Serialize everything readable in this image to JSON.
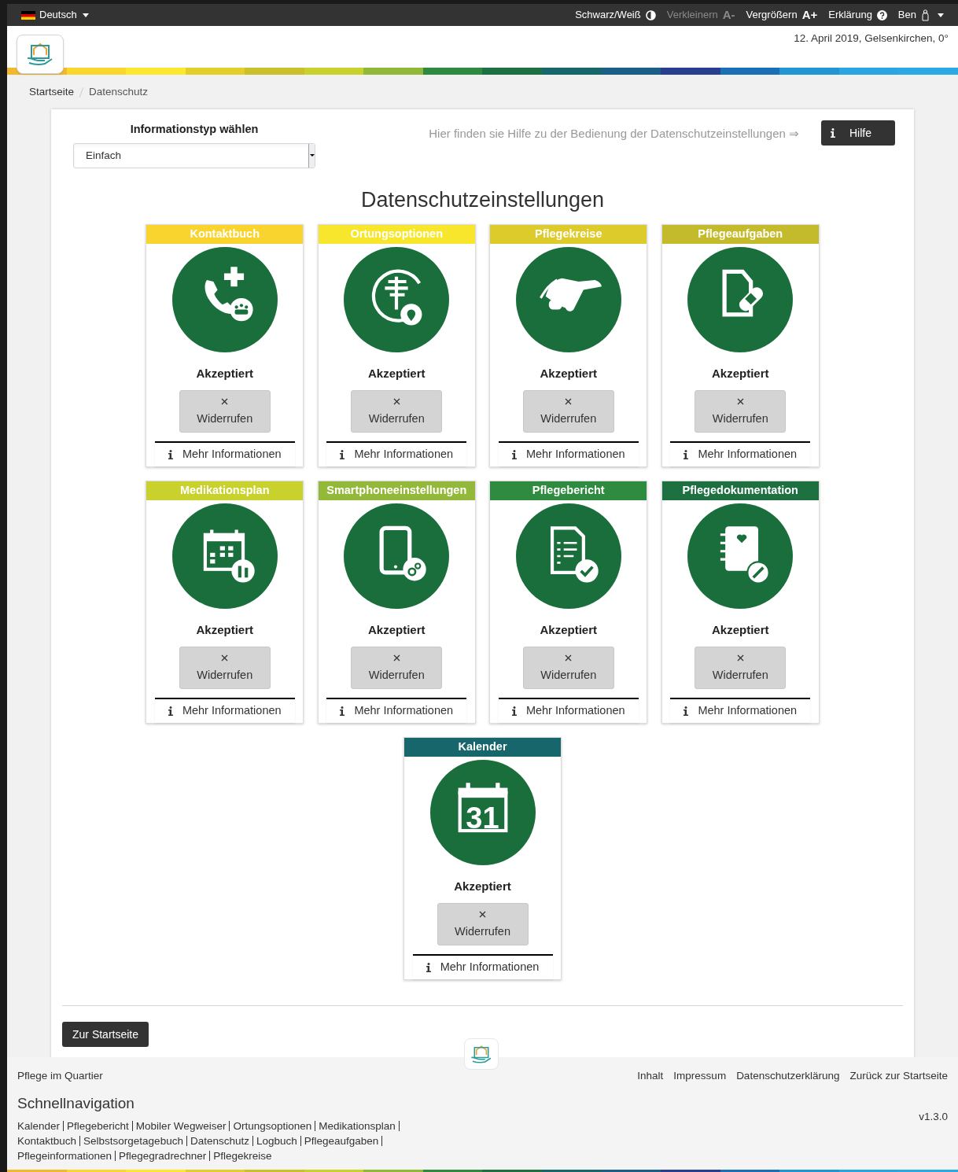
{
  "top_bar": {
    "language": {
      "label": "Deutsch"
    },
    "items": [
      {
        "kind": "contrast",
        "label": "Schwarz/Weiß",
        "disabled": false
      },
      {
        "kind": "font",
        "label": "Verkleinern",
        "symbol": "A-",
        "disabled": true
      },
      {
        "kind": "font",
        "label": "Vergrößern",
        "symbol": "A+",
        "disabled": false
      },
      {
        "kind": "help",
        "label": "Erklärung",
        "disabled": false
      },
      {
        "kind": "user",
        "label": "Ben",
        "disabled": false
      }
    ]
  },
  "header": {
    "date_location": "12. April 2019, Gelsenkirchen, 0°"
  },
  "breadcrumb": [
    "Startseite",
    "Datenschutz"
  ],
  "info_type": {
    "label": "Informationstyp wählen",
    "value": "Einfach"
  },
  "help": {
    "text": "Hier finden sie Hilfe zu der Bedienung der Datenschutzeinstellungen ⇒",
    "button": "Hilfe"
  },
  "title": "Datenschutzeinstellungen",
  "cards": [
    {
      "title": "Kontaktbuch",
      "color": "#f9d42e",
      "status": "Akzeptiert",
      "button": "Widerrufen",
      "more": "Mehr Informationen"
    },
    {
      "title": "Ortungsoptionen",
      "color": "#f8e62c",
      "status": "Akzeptiert",
      "button": "Widerrufen",
      "more": "Mehr Informationen"
    },
    {
      "title": "Pflegekreise",
      "color": "#dccb2b",
      "status": "Akzeptiert",
      "button": "Widerrufen",
      "more": "Mehr Informationen"
    },
    {
      "title": "Pflegeaufgaben",
      "color": "#c3bb2b",
      "status": "Akzeptiert",
      "button": "Widerrufen",
      "more": "Mehr Informationen"
    },
    {
      "title": "Medikationsplan",
      "color": "#c9d22c",
      "status": "Akzeptiert",
      "button": "Widerrufen",
      "more": "Mehr Informationen"
    },
    {
      "title": "Smartphoneeinstellungen",
      "color": "#94b83a",
      "status": "Akzeptiert",
      "button": "Widerrufen",
      "more": "Mehr Informationen"
    },
    {
      "title": "Pflegebericht",
      "color": "#2f8b3f",
      "status": "Akzeptiert",
      "button": "Widerrufen",
      "more": "Mehr Informationen"
    },
    {
      "title": "Pflegedokumentation",
      "color": "#1e7041",
      "status": "Akzeptiert",
      "button": "Widerrufen",
      "more": "Mehr Informationen"
    },
    {
      "title": "Kalender",
      "color": "#16666b",
      "status": "Akzeptiert",
      "button": "Widerrufen",
      "more": "Mehr Informationen",
      "icon_label": "31"
    }
  ],
  "home_button": "Zur Startseite",
  "footer": {
    "brand": "Pflege im Quartier",
    "links": [
      "Inhalt",
      "Impressum",
      "Datenschutzerklärung",
      "Zurück zur Startseite"
    ],
    "quick_nav_title": "Schnellnavigation",
    "quick_nav_lines": [
      [
        "Kalender",
        "Pflegebericht",
        "Mobiler Wegweiser",
        "Ortungsoptionen",
        "Medikationsplan"
      ],
      [
        "Kontaktbuch",
        "Selbstsorgetagebuch",
        "Datenschutz",
        "Logbuch",
        "Pflegeaufgaben"
      ],
      [
        "Pflegeinformationen",
        "Pflegegradrechner",
        "Pflegekreise"
      ]
    ],
    "version": "v1.3.0"
  }
}
